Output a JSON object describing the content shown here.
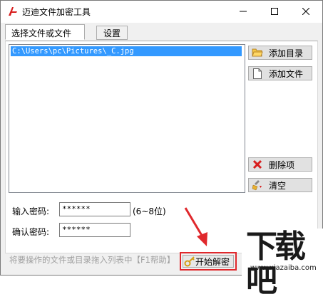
{
  "window": {
    "title": "迈迪文件加密工具"
  },
  "tabs": [
    {
      "label": "选择文件或文件夹",
      "active": true
    },
    {
      "label": "设置",
      "active": false
    }
  ],
  "file_list": {
    "items": [
      "C:\\Users\\pc\\Pictures\\_C.jpg"
    ],
    "selected_index": 0
  },
  "buttons": {
    "add_dir": "添加目录",
    "add_file": "添加文件",
    "delete_item": "删除项",
    "clear": "清空",
    "start": "开始解密"
  },
  "password": {
    "input_label": "输入密码:",
    "input_value": "******",
    "hint": "(6~8位)",
    "confirm_label": "确认密码:",
    "confirm_value": "******"
  },
  "status_text": "将要操作的文件或目录拖入列表中【F1帮助】",
  "watermark": {
    "text": "下载吧",
    "site": "www.xiazaiba.com"
  },
  "colors": {
    "selection": "#3399ff",
    "highlight_border": "#e0282c",
    "arrow": "#e0282c"
  }
}
